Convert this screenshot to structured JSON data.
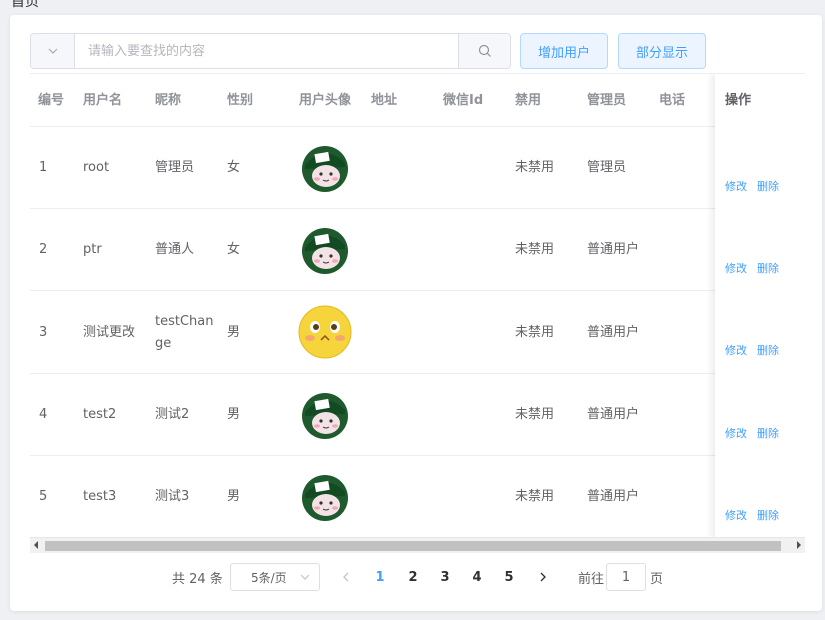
{
  "breadcrumb": "首页",
  "toolbar": {
    "search_placeholder": "请输入要查找的内容",
    "add_user_label": "增加用户",
    "partial_display_label": "部分显示"
  },
  "table": {
    "columns": [
      "编号",
      "用户名",
      "昵称",
      "性别",
      "用户头像",
      "地址",
      "微信Id",
      "禁用",
      "管理员",
      "电话",
      "操作"
    ],
    "rows": [
      {
        "id": "1",
        "username": "root",
        "nickname": "管理员",
        "gender": "女",
        "avatar": "green-hat-avatar",
        "address": "",
        "wechat": "",
        "disabled": "未禁用",
        "admin": "管理员",
        "phone": ""
      },
      {
        "id": "2",
        "username": "ptr",
        "nickname": "普通人",
        "gender": "女",
        "avatar": "green-hat-avatar",
        "address": "",
        "wechat": "",
        "disabled": "未禁用",
        "admin": "普通用户",
        "phone": ""
      },
      {
        "id": "3",
        "username": "测试更改",
        "nickname": "testChange",
        "gender": "男",
        "avatar": "yellow-face-avatar",
        "address": "",
        "wechat": "",
        "disabled": "未禁用",
        "admin": "普通用户",
        "phone": ""
      },
      {
        "id": "4",
        "username": "test2",
        "nickname": "测试2",
        "gender": "男",
        "avatar": "green-hat-avatar",
        "address": "",
        "wechat": "",
        "disabled": "未禁用",
        "admin": "普通用户",
        "phone": ""
      },
      {
        "id": "5",
        "username": "test3",
        "nickname": "测试3",
        "gender": "男",
        "avatar": "green-hat-avatar",
        "address": "",
        "wechat": "",
        "disabled": "未禁用",
        "admin": "普通用户",
        "phone": ""
      }
    ],
    "edit_label": "修改",
    "delete_label": "删除"
  },
  "pagination": {
    "total_text": "共 24 条",
    "page_size": "5条/页",
    "pages": [
      "1",
      "2",
      "3",
      "4",
      "5"
    ],
    "current_page": "1",
    "goto_label": "前往",
    "goto_value": "1",
    "goto_unit": "页"
  },
  "colors": {
    "accent": "#409eff",
    "accent_bg": "#ecf5ff",
    "header_text": "#909399"
  }
}
